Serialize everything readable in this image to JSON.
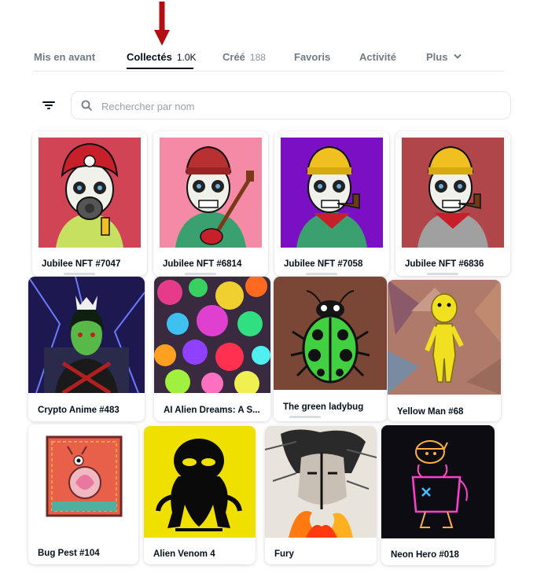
{
  "tabs": [
    {
      "label": "Mis en avant",
      "count": ""
    },
    {
      "label": "Collectés",
      "count": "1.0K"
    },
    {
      "label": "Créé",
      "count": "188"
    },
    {
      "label": "Favoris",
      "count": ""
    },
    {
      "label": "Activité",
      "count": ""
    },
    {
      "label": "Plus",
      "count": ""
    }
  ],
  "active_tab": "Collectés",
  "search": {
    "placeholder": "Rechercher par nom"
  },
  "colors": {
    "annotation_arrow": "#b01010",
    "active": "#04111d",
    "muted": "#707a83"
  },
  "cards": [
    {
      "name": "Jubilee NFT #7047",
      "icon": "skull-firefighter-gasmask",
      "bg": "#d04455"
    },
    {
      "name": "Jubilee NFT #6814",
      "icon": "skull-beanie-guitar",
      "bg": "#f48aa6"
    },
    {
      "name": "Jubilee NFT #7058",
      "icon": "skull-yellow-beanie-pipe",
      "bg": "#7a0fc4"
    },
    {
      "name": "Jubilee NFT #6836",
      "icon": "skull-yellow-beanie-pipe",
      "bg": "#b0464a"
    },
    {
      "name": "Crypto Anime #483",
      "icon": "anime-green-woman",
      "bg": "#1e1850"
    },
    {
      "name": "AI Alien Dreams: A S...",
      "icon": "colorful-alien-landscape",
      "bg": "#3a2a40"
    },
    {
      "name": "The green ladybug",
      "icon": "green-ladybug",
      "bg": "#7a4636"
    },
    {
      "name": "Yellow Man #68",
      "icon": "yellow-man-abstract",
      "bg": "#b07a6a"
    },
    {
      "name": "Bug Pest #104",
      "icon": "bug-pest-illustration",
      "bg": "#e9604a"
    },
    {
      "name": "Alien Venom 4",
      "icon": "alien-venom-silhouette",
      "bg": "#f0e000"
    },
    {
      "name": "Fury",
      "icon": "fury-face-fire",
      "bg": "#e8e4dc"
    },
    {
      "name": "Neon Hero #018",
      "icon": "neon-caveman",
      "bg": "#0c0c12"
    }
  ]
}
